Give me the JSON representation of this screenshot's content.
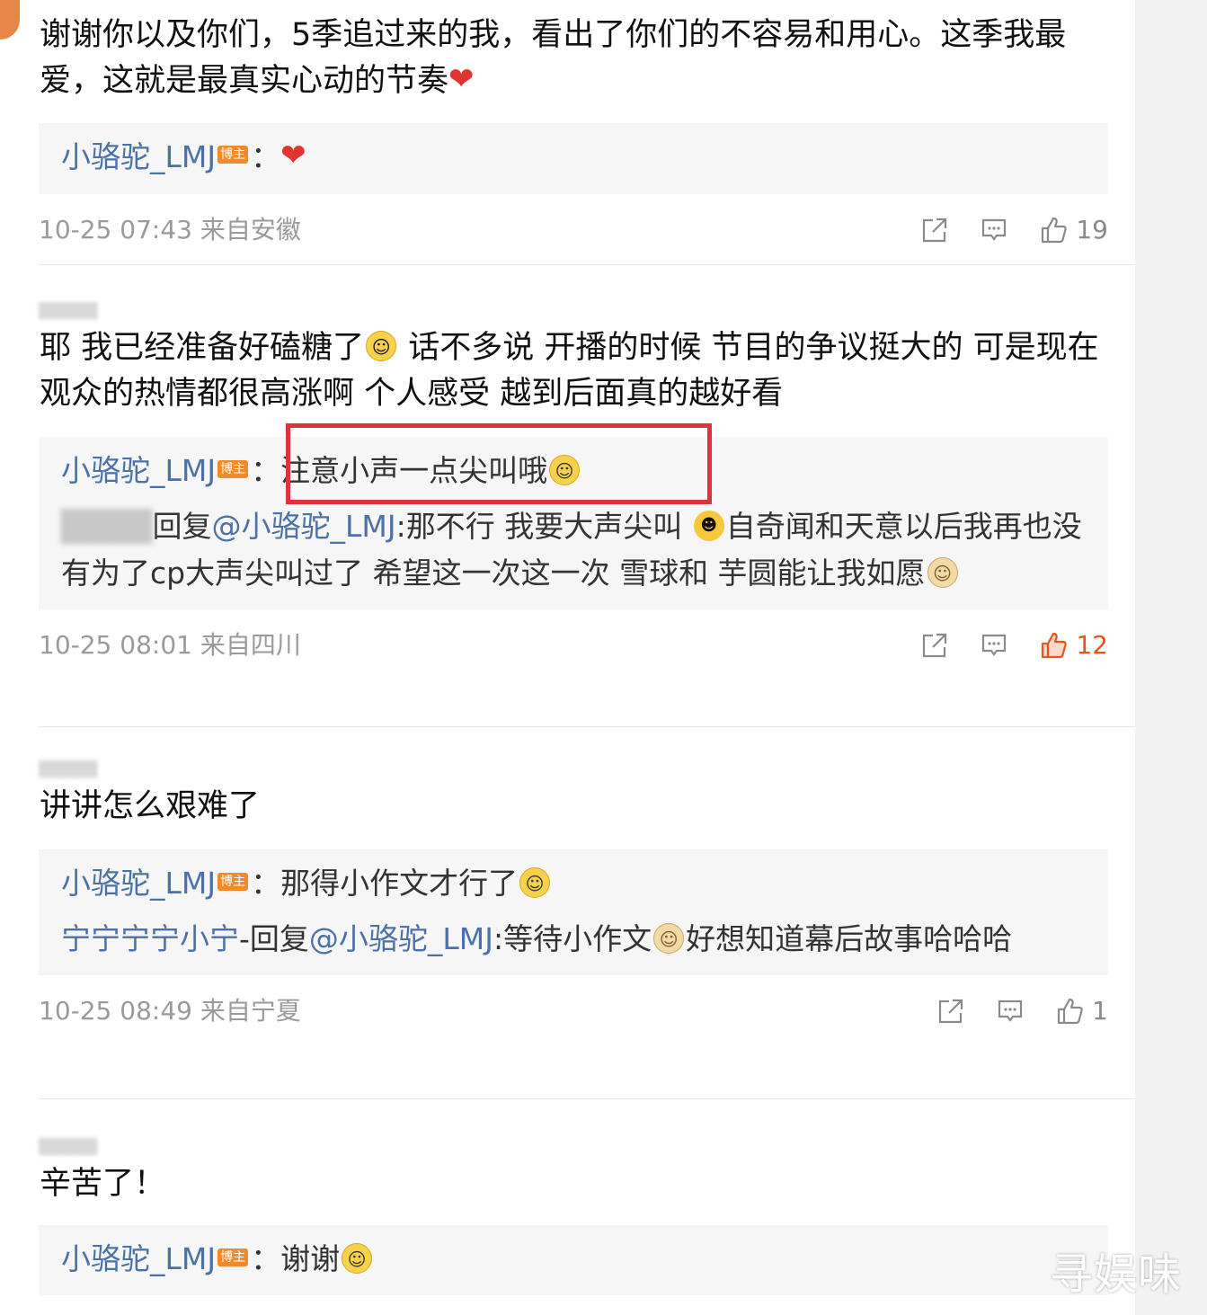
{
  "comments": [
    {
      "text": "谢谢你以及你们，5季追过来的我，看出了你们的不容易和用心。这季我最爱，这就是最真实心动的节奏",
      "replies": [
        {
          "user": "小骆驼_LMJ",
          "badge": "博主",
          "sep": "：",
          "text": ""
        }
      ],
      "time": "10-25 07:43",
      "location": "来自安徽",
      "likes": "19",
      "liked": false
    },
    {
      "text_a": "耶 我已经准备好磕糖了",
      "text_b": " 话不多说 开播的时候 节目的争议挺大的 可是现在 观众的热情都很高涨啊 个人感受 越到后面真的越好看",
      "replies": [
        {
          "user": "小骆驼_LMJ",
          "badge": "博主",
          "sep": "：",
          "text": "注意小声一点尖叫哦"
        },
        {
          "user": "",
          "mid": "回复",
          "at": "@小骆驼_LMJ",
          "text_a": ":那不行 我要大声尖叫 ",
          "text_b": "自奇闻和天意以后我再也没有为了cp大声尖叫过了 希望这一次这一次 雪球和 芋圆能让我如愿"
        }
      ],
      "time": "10-25 08:01",
      "location": "来自四川",
      "likes": "12",
      "liked": true
    },
    {
      "text": "讲讲怎么艰难了",
      "replies": [
        {
          "user": "小骆驼_LMJ",
          "badge": "博主",
          "sep": "：",
          "text": "那得小作文才行了"
        },
        {
          "user": "宁宁宁宁小宁",
          "mid": "-回复",
          "at": "@小骆驼_LMJ",
          "text_a": ":等待小作文",
          "text_b": "好想知道幕后故事哈哈哈"
        }
      ],
      "time": "10-25 08:49",
      "location": "来自宁夏",
      "likes": "1",
      "liked": false
    },
    {
      "text": "辛苦了！",
      "replies": [
        {
          "user": "小骆驼_LMJ",
          "badge": "博主",
          "sep": "：",
          "text": "谢谢"
        }
      ]
    }
  ],
  "watermark": "寻娱味",
  "colors": {
    "username": "#4a72a8",
    "liked": "#e8541e",
    "highlight_box": "#e0323c",
    "badge": "#f08a2a"
  },
  "icons": [
    "share-icon",
    "comment-icon",
    "like-icon",
    "heart-emoji",
    "laughing-emoji",
    "shy-emoji",
    "cool-emoji",
    "doge-emoji",
    "tears-of-joy-emoji",
    "smile-emoji"
  ]
}
